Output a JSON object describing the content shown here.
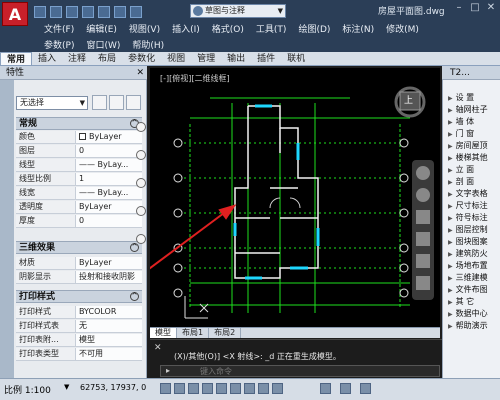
{
  "app": {
    "logo_text": "A",
    "document_title": "房屋平面图.dwg",
    "workspace": "草图与注释"
  },
  "menubar": {
    "row1": [
      "文件(F)",
      "编辑(E)",
      "视图(V)",
      "插入(I)",
      "格式(O)",
      "工具(T)",
      "绘图(D)",
      "标注(N)",
      "修改(M)"
    ],
    "row2": [
      "参数(P)",
      "窗口(W)",
      "帮助(H)"
    ]
  },
  "ribbon_tabs": [
    "常用",
    "插入",
    "注释",
    "布局",
    "参数化",
    "视图",
    "管理",
    "输出",
    "插件",
    "联机"
  ],
  "properties": {
    "title": "特性",
    "selection": "无选择",
    "sections": {
      "general": "常规",
      "threed": "三维效果",
      "plot": "打印样式"
    },
    "general_rows": [
      {
        "label": "颜色",
        "value": "ByLayer"
      },
      {
        "label": "图层",
        "value": "0"
      },
      {
        "label": "线型",
        "value": "—— ByLay..."
      },
      {
        "label": "线型比例",
        "value": "1"
      },
      {
        "label": "线宽",
        "value": "—— ByLay..."
      },
      {
        "label": "透明度",
        "value": "ByLayer"
      },
      {
        "label": "厚度",
        "value": "0"
      }
    ],
    "threed_rows": [
      {
        "label": "材质",
        "value": "ByLayer"
      },
      {
        "label": "阴影显示",
        "value": "投射和接收阴影"
      }
    ],
    "plot_rows": [
      {
        "label": "打印样式",
        "value": "BYCOLOR"
      },
      {
        "label": "打印样式表",
        "value": "无"
      },
      {
        "label": "打印表附...",
        "value": "模型"
      },
      {
        "label": "打印表类型",
        "value": "不可用"
      }
    ]
  },
  "canvas": {
    "viewport_label": "[-][俯视][二维线框]",
    "viewcube_face": "上"
  },
  "layout_tabs": [
    "模型",
    "布局1",
    "布局2"
  ],
  "command": {
    "history": "(X)/其他(O)] <X 射线>: _d 正在重生成模型。",
    "placeholder": "键入命令"
  },
  "tool_palette": {
    "title": "T2...",
    "items": [
      "设 置",
      "轴网柱子",
      "墙 体",
      "门 窗",
      "房间屋顶",
      "楼梯其他",
      "立 面",
      "剖 面",
      "文字表格",
      "尺寸标注",
      "符号标注",
      "图层控制",
      "图块图案",
      "建筑防火",
      "场地布置",
      "三维建模",
      "文件布图",
      "其 它",
      "数据中心",
      "帮助演示"
    ]
  },
  "status": {
    "scale": "比例 1:100",
    "coordinates": "62753, 17937, 0"
  }
}
